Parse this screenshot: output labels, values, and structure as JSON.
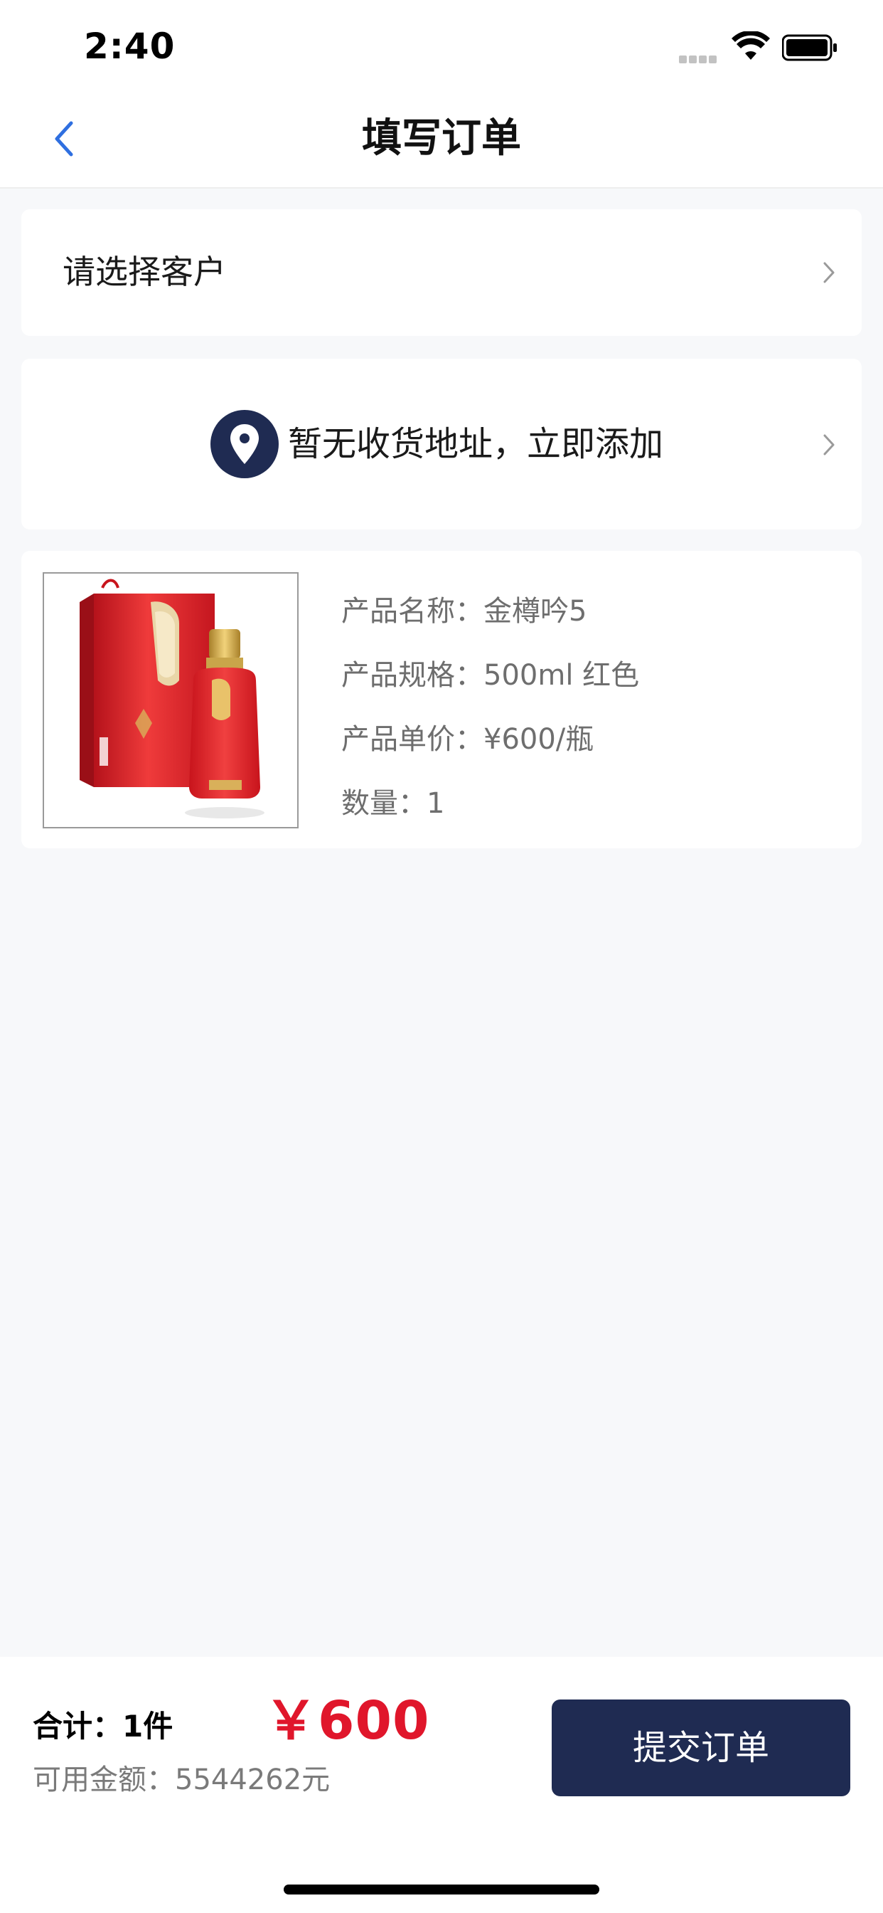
{
  "status_bar": {
    "time": "2:40"
  },
  "nav": {
    "title": "填写订单"
  },
  "customer": {
    "label": "请选择客户"
  },
  "address": {
    "label": "暂无收货地址，立即添加"
  },
  "product": {
    "name_label": "产品名称：",
    "name": "金樽吟5",
    "spec_label": "产品规格：",
    "spec": "500ml 红色",
    "price_label": "产品单价：",
    "price": "¥600/瓶",
    "quantity_label": "数量：",
    "quantity": "1"
  },
  "bottom": {
    "total_label": "合计：",
    "total_count": "1件",
    "total_amount": "￥600",
    "balance_label": "可用金额：",
    "balance": "5544262元",
    "submit_label": "提交订单"
  },
  "colors": {
    "accent_blue": "#2f6fe0",
    "price_red": "#e0162b",
    "button_navy": "#1f2b52"
  }
}
